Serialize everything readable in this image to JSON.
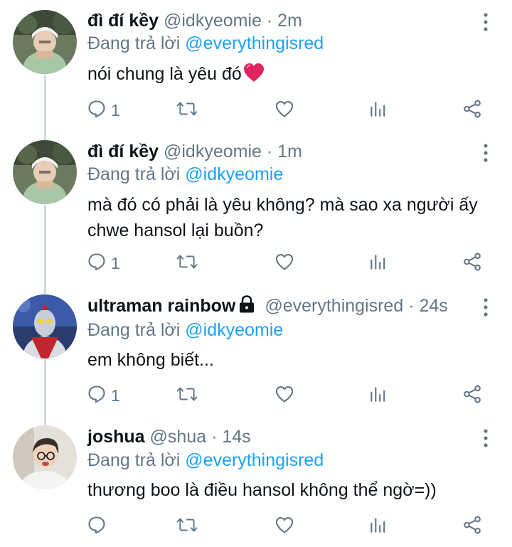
{
  "tweets": [
    {
      "name": "đì đí kềy",
      "handle": "@idkyeomie",
      "separator": "·",
      "time": "2m",
      "reply_prefix": "Đang trả lời",
      "reply_to": "@everythingisred",
      "text": "nói chung là yêu đó",
      "emoji": "red-heart",
      "reply_count": "1"
    },
    {
      "name": "đì đí kềy",
      "handle": "@idkyeomie",
      "separator": "·",
      "time": "1m",
      "reply_prefix": "Đang trả lời",
      "reply_to": "@idkyeomie",
      "text": "mà đó có phải là yêu không? mà sao xa người ấy chwe hansol lại buồn?",
      "reply_count": "1"
    },
    {
      "name": "ultraman rainbow",
      "protected": true,
      "handle": "@everythingisred",
      "separator": "·",
      "time": "24s",
      "reply_prefix": "Đang trả lời",
      "reply_to": "@idkyeomie",
      "text": "em không biết...",
      "reply_count": "1"
    },
    {
      "name": "joshua",
      "handle": "@shua",
      "separator": "·",
      "time": "14s",
      "reply_prefix": "Đang trả lời",
      "reply_to": "@everythingisred",
      "text": "thương boo là điều hansol không thể ngờ=))",
      "reply_count": ""
    }
  ],
  "icons": {
    "reply": "reply-icon",
    "retweet": "retweet-icon",
    "like": "like-icon",
    "analytics": "analytics-icon",
    "share": "share-icon",
    "more": "more-icon",
    "lock": "lock-icon"
  },
  "colors": {
    "mention": "#1da1f2",
    "secondary_text": "#657786",
    "primary_text": "#0f1419",
    "thread_line": "#cfd9de",
    "heart": "#e0245e"
  }
}
